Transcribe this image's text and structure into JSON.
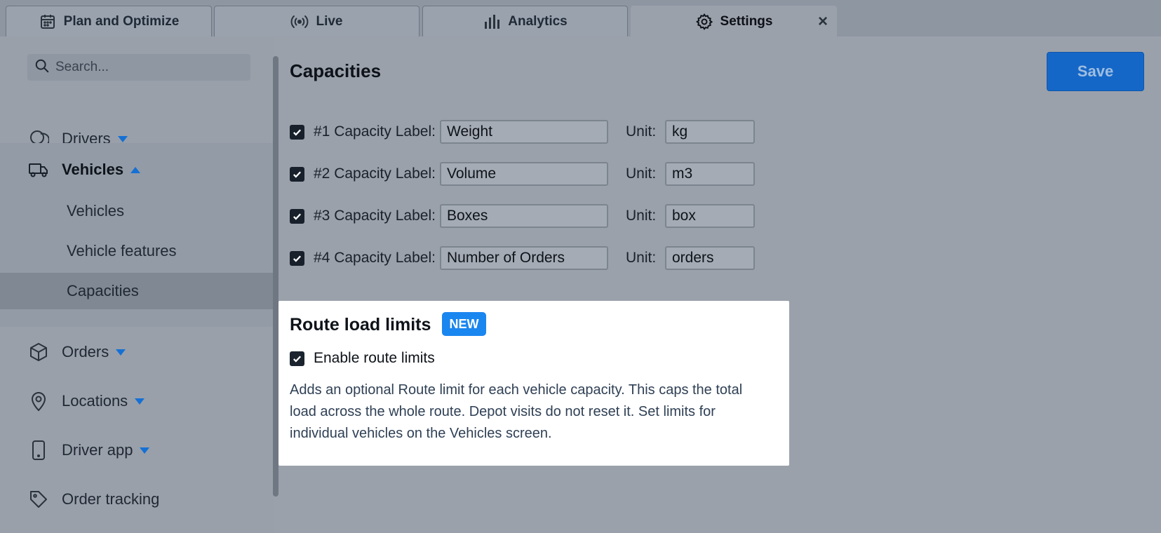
{
  "tabs": [
    {
      "label": "Plan and Optimize",
      "icon": "calendar-icon",
      "active": false
    },
    {
      "label": "Live",
      "icon": "broadcast-icon",
      "active": false
    },
    {
      "label": "Analytics",
      "icon": "bar-chart-icon",
      "active": false
    },
    {
      "label": "Settings",
      "icon": "gear-icon",
      "active": true
    }
  ],
  "tab_close": "×",
  "search": {
    "placeholder": "Search..."
  },
  "sidebar": {
    "items": [
      {
        "label": "Drivers",
        "icon": "drivers-icon",
        "expanded": false
      },
      {
        "label": "Vehicles",
        "icon": "truck-icon",
        "expanded": true
      },
      {
        "label": "Orders",
        "icon": "box-icon",
        "expanded": false
      },
      {
        "label": "Locations",
        "icon": "location-pin-icon",
        "expanded": false
      },
      {
        "label": "Driver app",
        "icon": "phone-icon",
        "expanded": false
      },
      {
        "label": "Order tracking",
        "icon": "tag-icon",
        "expanded": false
      }
    ],
    "vehicles_sub": [
      "Vehicles",
      "Vehicle features",
      "Capacities"
    ],
    "active_sub": "Capacities"
  },
  "main": {
    "title": "Capacities",
    "save_label": "Save",
    "capacities": [
      {
        "label": "#1 Capacity Label:",
        "value": "Weight",
        "unit_label": "Unit:",
        "unit": "kg",
        "checked": true
      },
      {
        "label": "#2 Capacity Label:",
        "value": "Volume",
        "unit_label": "Unit:",
        "unit": "m3",
        "checked": true
      },
      {
        "label": "#3 Capacity Label:",
        "value": "Boxes",
        "unit_label": "Unit:",
        "unit": "box",
        "checked": true
      },
      {
        "label": "#4 Capacity Label:",
        "value": "Number of Orders",
        "unit_label": "Unit:",
        "unit": "orders",
        "checked": true
      }
    ]
  },
  "panel": {
    "title": "Route load limits",
    "badge": "NEW",
    "enable_label": "Enable route limits",
    "enabled": true,
    "description": "Adds an optional Route limit for each vehicle capacity. This caps the total load across the whole route. Depot visits do not reset it. Set limits for individual vehicles on the Vehicles screen."
  },
  "colors": {
    "accent": "#1567c7",
    "badge": "#1a86f0",
    "overlay": "#9ba1ab"
  }
}
